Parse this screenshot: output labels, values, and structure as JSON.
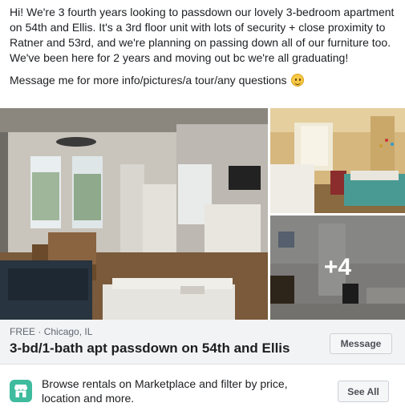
{
  "post": {
    "paragraph1": "Hi! We're 3 fourth years looking to passdown our lovely 3-bedroom apartment on 54th and Ellis. It's a 3rd floor unit with lots of security + close proximity to Ratner and 53rd, and we're planning on passing down all of our furniture too. We've been here for 2 years and moving out bc we're all graduating!",
    "paragraph2": "Message me for more info/pictures/a tour/any questions",
    "emoji": "smiling-face-icon"
  },
  "photos": {
    "more_count": "+4"
  },
  "listing": {
    "price": "FREE",
    "separator": " · ",
    "location": "Chicago, IL",
    "title": "3-bd/1-bath apt passdown on 54th and Ellis",
    "message_button": "Message"
  },
  "footer": {
    "icon": "marketplace-store-icon",
    "text": "Browse rentals on Marketplace and filter by price, location and more.",
    "see_all_button": "See All",
    "icon_color": "#3fbb9e"
  }
}
